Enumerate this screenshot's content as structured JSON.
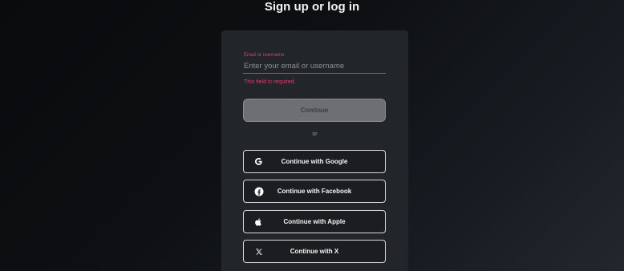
{
  "header": {
    "title": "Sign up or log in"
  },
  "form": {
    "field_label": "Email or username",
    "placeholder": "Enter your email or username",
    "value": "",
    "error": "This field is required.",
    "continue_label": "Continue",
    "divider": "or"
  },
  "providers": [
    {
      "label": "Continue with Google",
      "icon": "google-icon"
    },
    {
      "label": "Continue with Facebook",
      "icon": "facebook-icon"
    },
    {
      "label": "Continue with Apple",
      "icon": "apple-icon"
    },
    {
      "label": "Continue with X",
      "icon": "x-icon"
    }
  ],
  "colors": {
    "error": "#e8396a",
    "card": "#22252a",
    "disabled_button": "#6d6f73"
  }
}
